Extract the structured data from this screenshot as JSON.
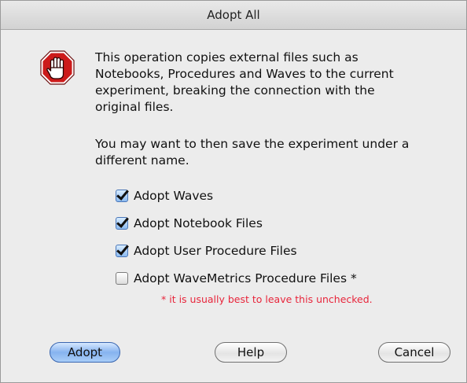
{
  "window": {
    "title": "Adopt All"
  },
  "message": {
    "paragraph1": "This operation copies external files such as\nNotebooks, Procedures and Waves to the current\nexperiment, breaking the connection with the\noriginal files.",
    "paragraph2": "You may want to then save the experiment under a\ndifferent name."
  },
  "icon": {
    "name": "stop-hand-icon",
    "color": "#cc1a1a"
  },
  "options": [
    {
      "label": "Adopt Waves",
      "checked": true
    },
    {
      "label": "Adopt Notebook Files",
      "checked": true
    },
    {
      "label": "Adopt User Procedure Files",
      "checked": true
    },
    {
      "label": "Adopt WaveMetrics Procedure Files *",
      "checked": false
    }
  ],
  "note": {
    "text": "* it is usually best to leave this unchecked.",
    "color": "#e8253b"
  },
  "buttons": {
    "adopt": "Adopt",
    "help": "Help",
    "cancel": "Cancel"
  }
}
